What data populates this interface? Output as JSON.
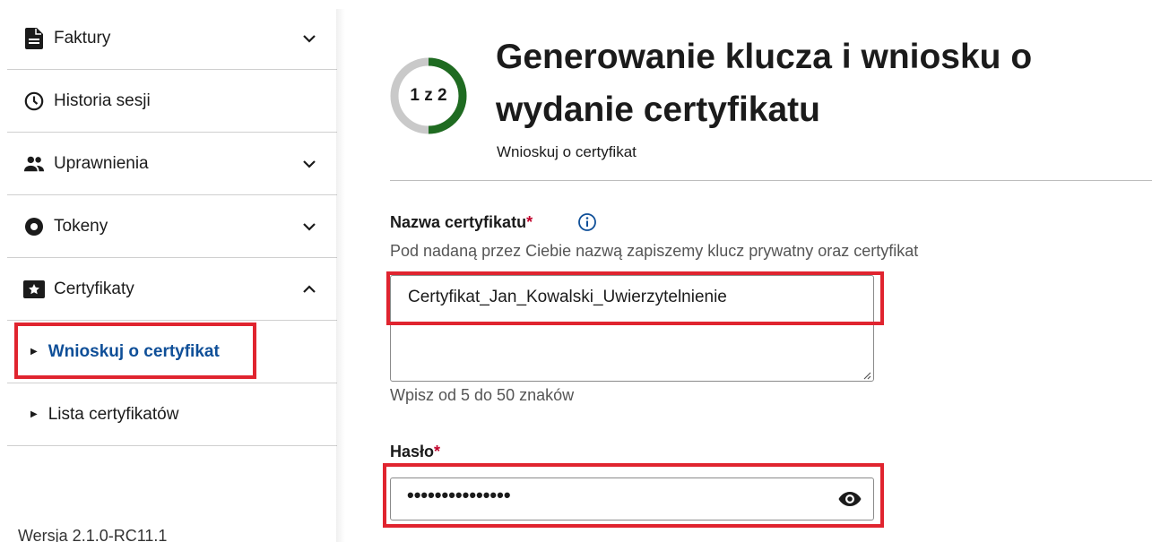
{
  "sidebar": {
    "items": [
      {
        "label": "Faktury",
        "icon": "document-icon",
        "expandable": true,
        "expanded": false
      },
      {
        "label": "Historia sesji",
        "icon": "clock-icon",
        "expandable": false
      },
      {
        "label": "Uprawnienia",
        "icon": "people-icon",
        "expandable": true,
        "expanded": false
      },
      {
        "label": "Tokeny",
        "icon": "token-icon",
        "expandable": true,
        "expanded": false
      },
      {
        "label": "Certyfikaty",
        "icon": "certificate-icon",
        "expandable": true,
        "expanded": true
      }
    ],
    "sub_items": [
      {
        "label": "Wnioskuj o certyfikat",
        "active": true
      },
      {
        "label": "Lista certyfikatów",
        "active": false
      }
    ],
    "version": "Wersja 2.1.0-RC11.1"
  },
  "main": {
    "step": {
      "text": "1 z 2",
      "current": 1,
      "total": 2
    },
    "title": "Generowanie klucza i wniosku o wydanie certyfikatu",
    "subtitle": "Wnioskuj o certyfikat",
    "cert_name": {
      "label": "Nazwa certyfikatu",
      "required_mark": "*",
      "hint": "Pod nadaną przez Ciebie nazwą zapiszemy klucz prywatny oraz certyfikat",
      "value": "Certyfikat_Jan_Kowalski_Uwierzytelnienie",
      "char_hint": "Wpisz od 5 do 50 znaków"
    },
    "password": {
      "label": "Hasło",
      "required_mark": "*",
      "masked_value": "•••••••••••••••"
    }
  },
  "colors": {
    "accent": "#0f4f98",
    "highlight": "#e0242f",
    "progress": "#1f6b21",
    "progress_track": "#c9c9c9",
    "required": "#c0002a"
  }
}
